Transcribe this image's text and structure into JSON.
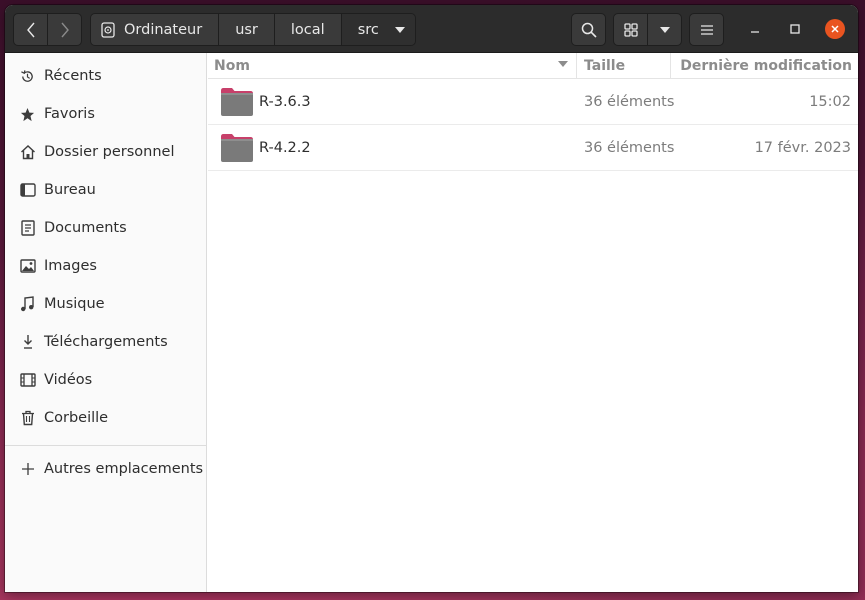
{
  "path_bar": {
    "crumbs": [
      "Ordinateur",
      "usr",
      "local",
      "src"
    ]
  },
  "sidebar": {
    "items": [
      {
        "label": "Récents",
        "icon": "clock-icon"
      },
      {
        "label": "Favoris",
        "icon": "star-icon"
      },
      {
        "label": "Dossier personnel",
        "icon": "home-icon"
      },
      {
        "label": "Bureau",
        "icon": "desktop-icon"
      },
      {
        "label": "Documents",
        "icon": "document-icon"
      },
      {
        "label": "Images",
        "icon": "image-icon"
      },
      {
        "label": "Musique",
        "icon": "music-icon"
      },
      {
        "label": "Téléchargements",
        "icon": "download-icon"
      },
      {
        "label": "Vidéos",
        "icon": "video-icon"
      },
      {
        "label": "Corbeille",
        "icon": "trash-icon"
      }
    ],
    "other_locations": {
      "label": "Autres emplacements",
      "icon": "plus-icon"
    }
  },
  "file_list": {
    "columns": {
      "name": "Nom",
      "size": "Taille",
      "modified": "Dernière modification"
    },
    "rows": [
      {
        "name": "R-3.6.3",
        "size": "36 éléments",
        "modified": "15:02"
      },
      {
        "name": "R-4.2.2",
        "size": "36 éléments",
        "modified": "17 févr. 2023"
      }
    ]
  },
  "colors": {
    "headerbar": "#2c2c2c",
    "accent_close": "#e95420",
    "folder_body": "#7a7a7a",
    "folder_tab": "#c7406a"
  }
}
